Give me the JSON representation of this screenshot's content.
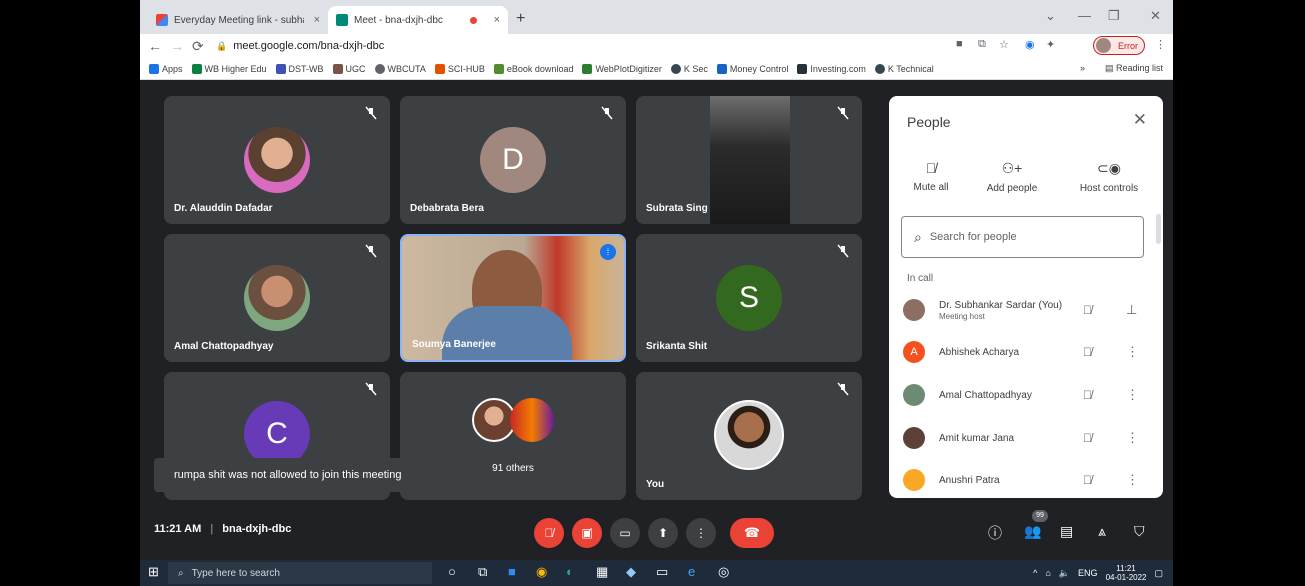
{
  "browser": {
    "tabs": [
      {
        "label": "Everyday Meeting link - subhank",
        "close": "×"
      },
      {
        "label": "Meet - bna-dxjh-dbc",
        "close": "×"
      }
    ],
    "new_tab": "+",
    "url": "meet.google.com/bna-dxjh-dbc",
    "profile_label": "Error",
    "window_controls": [
      "⌄",
      "—",
      "❐",
      "✕"
    ]
  },
  "bookmarks": {
    "items": [
      "Apps",
      "WB Higher Edu",
      "DST-WB",
      "UGC",
      "WBCUTA",
      "SCI-HUB",
      "eBook download",
      "WebPlotDigitizer",
      "K Sec",
      "Money Control",
      "Investing.com",
      "K Technical"
    ],
    "more": "»",
    "reading_list": "Reading list"
  },
  "tiles": [
    {
      "name": "Dr. Alauddin Dafadar",
      "kind": "photo"
    },
    {
      "name": "Debabrata Bera",
      "kind": "letter",
      "letter": "D",
      "color": "#a1887f"
    },
    {
      "name": "Subrata Sing",
      "kind": "video"
    },
    {
      "name": "Amal Chattopadhyay",
      "kind": "photo"
    },
    {
      "name": "Soumya Banerjee",
      "kind": "video"
    },
    {
      "name": "Srikanta Shit",
      "kind": "letter",
      "letter": "S",
      "color": "#33691e"
    },
    {
      "name": "",
      "kind": "letter",
      "letter": "C",
      "color": "#673ab7"
    },
    {
      "name": "91 others",
      "kind": "group"
    },
    {
      "name": "You",
      "kind": "photo"
    }
  ],
  "toast": "rumpa shit was not allowed to join this meeting",
  "people_panel": {
    "title": "People",
    "close": "✕",
    "actions": [
      {
        "label": "Mute all",
        "icon": "mic-off-icon"
      },
      {
        "label": "Add people",
        "icon": "add-person-icon"
      },
      {
        "label": "Host controls",
        "icon": "toggle-icon"
      }
    ],
    "search_placeholder": "Search for people",
    "section_label": "In call",
    "participants": [
      {
        "name": "Dr. Subhankar Sardar (You)",
        "sub": "Meeting host",
        "avatar_color": "#8d6e63",
        "letter": ""
      },
      {
        "name": "Abhishek Acharya",
        "sub": "",
        "avatar_color": "#f4511e",
        "letter": "A"
      },
      {
        "name": "Amal Chattopadhyay",
        "sub": "",
        "avatar_color": "#6d8b74",
        "letter": ""
      },
      {
        "name": "Amit kumar Jana",
        "sub": "",
        "avatar_color": "#5d4037",
        "letter": ""
      },
      {
        "name": "Anushri Patra",
        "sub": "",
        "avatar_color": "#f9a825",
        "letter": ""
      }
    ]
  },
  "bottom_bar": {
    "time": "11:21 AM",
    "separator": "|",
    "meeting_code": "bna-dxjh-dbc",
    "participant_badge": "99"
  },
  "taskbar": {
    "search_placeholder": "Type here to search",
    "language": "ENG",
    "clock_time": "11:21",
    "clock_date": "04-01-2022"
  }
}
